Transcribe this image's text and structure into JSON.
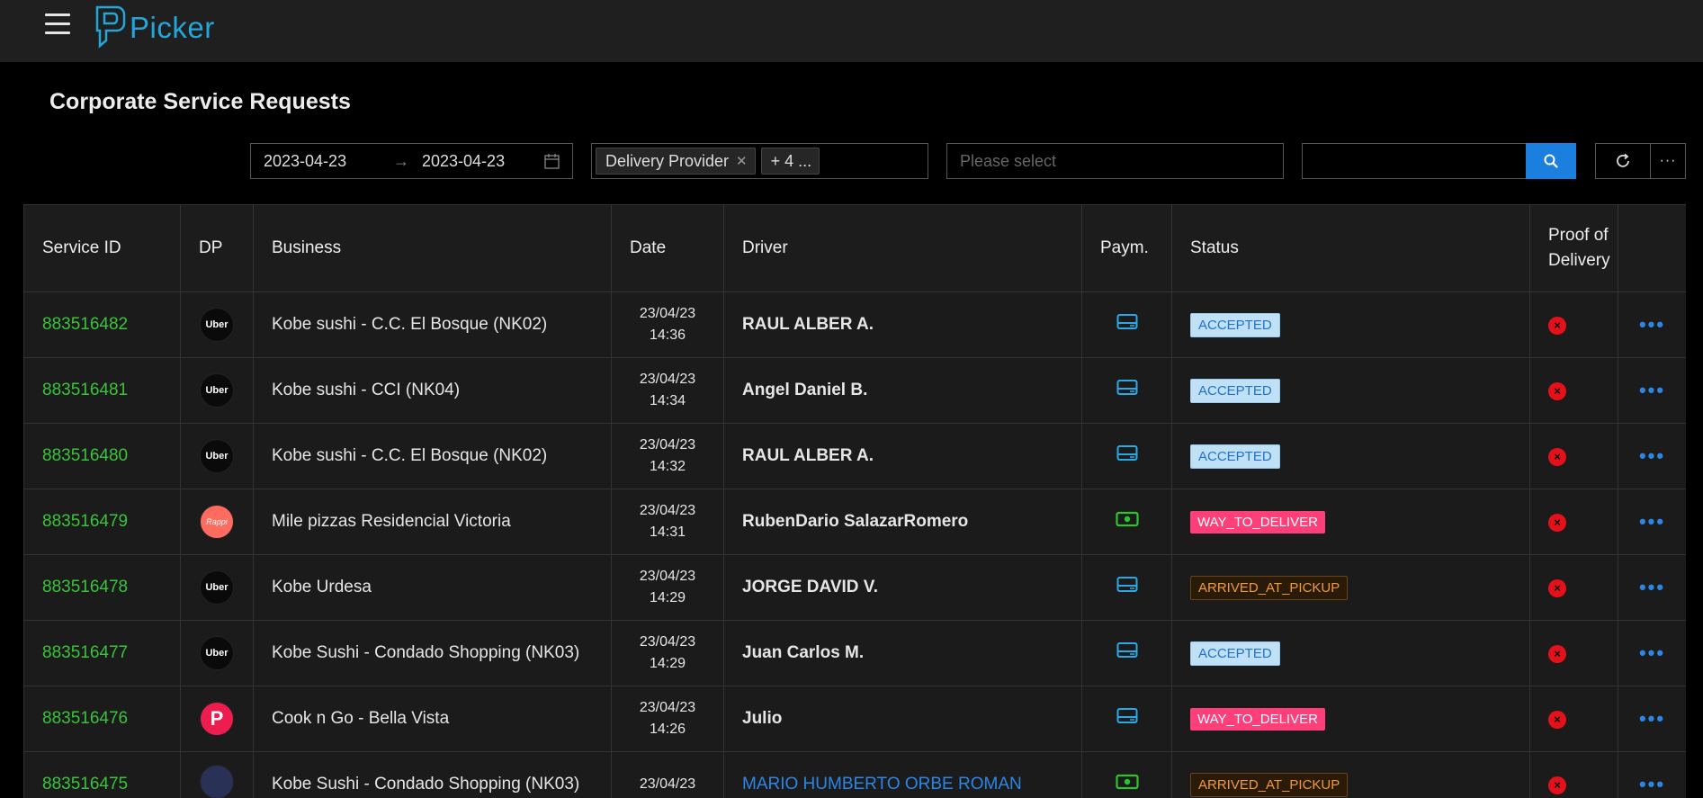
{
  "app": {
    "name": "Picker"
  },
  "page": {
    "title": "Corporate Service Requests"
  },
  "filters": {
    "date_from": "2023-04-23",
    "date_to": "2023-04-23",
    "provider_tag": "Delivery Provider",
    "provider_more": "+ 4 ...",
    "select_placeholder": "Please select",
    "search_value": ""
  },
  "table": {
    "headers": {
      "service_id": "Service ID",
      "dp": "DP",
      "business": "Business",
      "date": "Date",
      "driver": "Driver",
      "payment": "Paym.",
      "status": "Status",
      "pod": "Proof of Delivery"
    },
    "rows": [
      {
        "id": "883516482",
        "dp": "Uber",
        "business": "Kobe sushi - C.C. El Bosque (NK02)",
        "date": "23/04/23",
        "time": "14:36",
        "driver": "RAUL ALBER A.",
        "payment": "card",
        "status": "ACCEPTED"
      },
      {
        "id": "883516481",
        "dp": "Uber",
        "business": "Kobe sushi - CCI (NK04)",
        "date": "23/04/23",
        "time": "14:34",
        "driver": "Angel Daniel B.",
        "payment": "card",
        "status": "ACCEPTED"
      },
      {
        "id": "883516480",
        "dp": "Uber",
        "business": "Kobe sushi - C.C. El Bosque (NK02)",
        "date": "23/04/23",
        "time": "14:32",
        "driver": "RAUL ALBER A.",
        "payment": "card",
        "status": "ACCEPTED"
      },
      {
        "id": "883516479",
        "dp": "Rappi",
        "business": "Mile pizzas Residencial Victoria",
        "date": "23/04/23",
        "time": "14:31",
        "driver": "RubenDario SalazarRomero",
        "payment": "cash",
        "status": "WAY_TO_DELIVER"
      },
      {
        "id": "883516478",
        "dp": "Uber",
        "business": "Kobe Urdesa",
        "date": "23/04/23",
        "time": "14:29",
        "driver": "JORGE DAVID V.",
        "payment": "card",
        "status": "ARRIVED_AT_PICKUP"
      },
      {
        "id": "883516477",
        "dp": "Uber",
        "business": "Kobe Sushi - Condado Shopping (NK03)",
        "date": "23/04/23",
        "time": "14:29",
        "driver": "Juan Carlos M.",
        "payment": "card",
        "status": "ACCEPTED"
      },
      {
        "id": "883516476",
        "dp": "P",
        "business": "Cook n Go - Bella Vista",
        "date": "23/04/23",
        "time": "14:26",
        "driver": "Julio",
        "payment": "card",
        "status": "WAY_TO_DELIVER"
      },
      {
        "id": "883516475",
        "dp": "",
        "business": "Kobe Sushi - Condado Shopping (NK03)",
        "date": "23/04/23",
        "time": "",
        "driver": "MARIO HUMBERTO ORBE ROMAN",
        "payment": "cash",
        "status": "ARRIVED_AT_PICKUP"
      }
    ]
  },
  "colors": {
    "accent": "#1b7fe0",
    "id_green": "#3ac33a",
    "logo_blue": "#24a6d9"
  }
}
